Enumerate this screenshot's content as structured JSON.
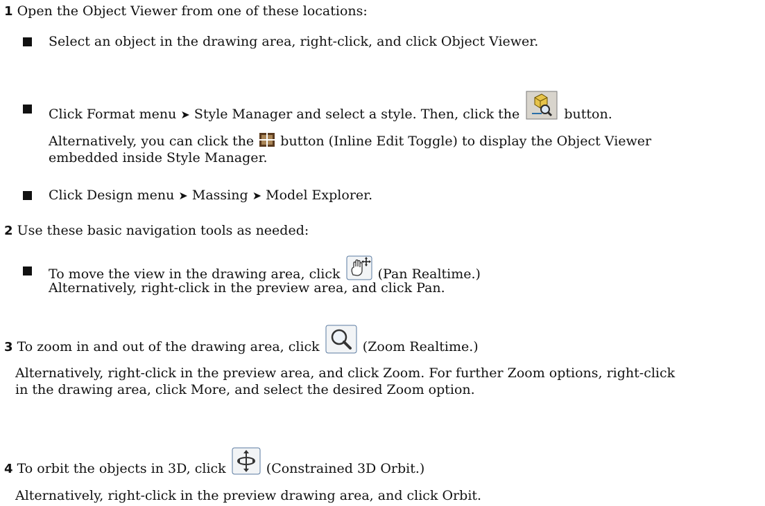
{
  "step1": {
    "number": "1",
    "text": "Open the Object Viewer from one of these locations:",
    "bullets": {
      "b1": "Select an object in the drawing area, right-click, and click Object Viewer.",
      "b2_pre": "Click Format menu",
      "b2_mid": "Style Manager and select a style. Then, click the",
      "b2_post": "button.",
      "b2_alt_pre": "Alternatively, you can click the",
      "b2_alt_post": "button (Inline Edit Toggle) to display the Object Viewer",
      "b2_alt_cont": "embedded inside Style Manager.",
      "b3_a": "Click Design menu",
      "b3_b": "Massing",
      "b3_c": "Model Explorer."
    }
  },
  "step2": {
    "number": "2",
    "text": "Use these basic navigation tools as needed:",
    "bullet_pre": "To move the view in the drawing area, click",
    "bullet_post": "(Pan Realtime.)",
    "bullet_alt": "Alternatively, right-click in the preview area, and click Pan."
  },
  "step3": {
    "number": "3",
    "pre": "To zoom in and out of the drawing area, click",
    "post": "(Zoom Realtime.)",
    "alt1": "Alternatively, right-click in the preview area, and click Zoom. For further Zoom options, right-click",
    "alt2": "in the drawing area, click More, and select the desired Zoom option."
  },
  "step4": {
    "number": "4",
    "pre": "To orbit the objects in 3D, click",
    "post": "(Constrained 3D Orbit.)",
    "alt": "Alternatively, right-click in the preview drawing area, and click Orbit."
  },
  "arrow": "➤",
  "icons": [
    "object-viewer-icon",
    "inline-edit-toggle-icon",
    "pan-realtime-icon",
    "zoom-realtime-icon",
    "constrained-orbit-icon"
  ]
}
